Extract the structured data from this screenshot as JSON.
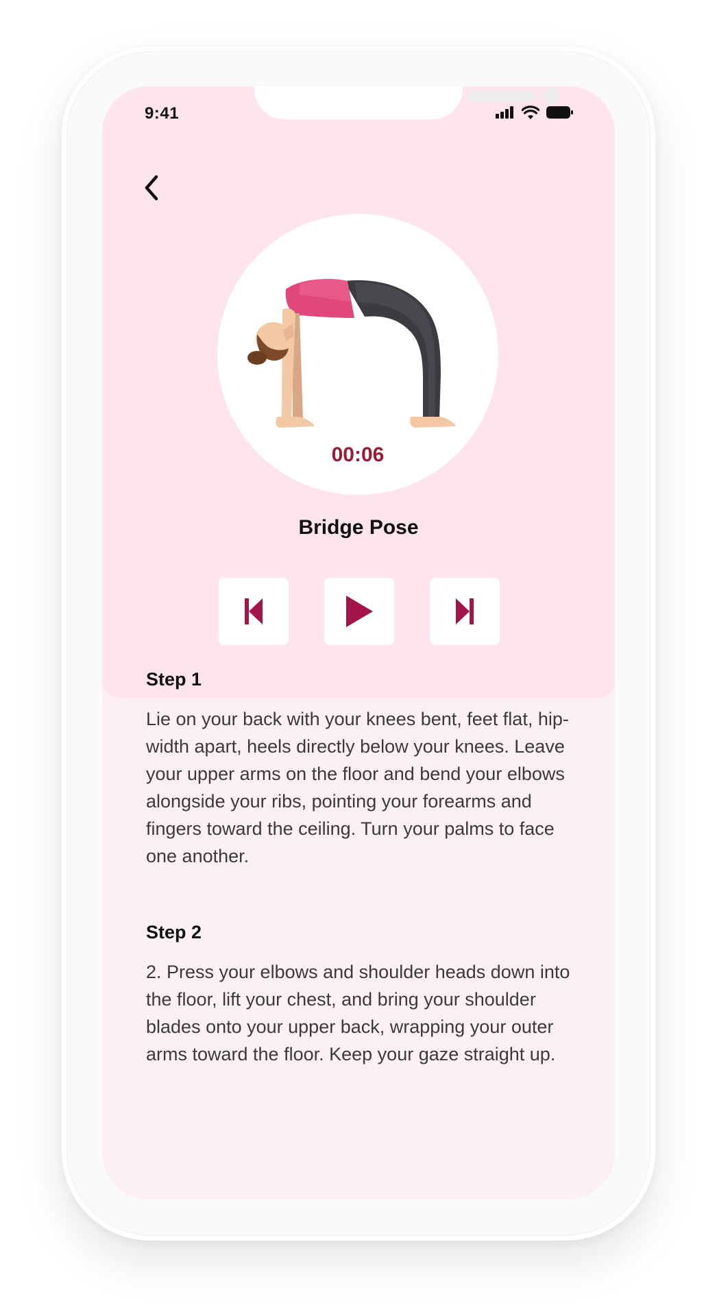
{
  "status_bar": {
    "time": "9:41",
    "icons": [
      "signal-icon",
      "wifi-icon",
      "battery-icon"
    ]
  },
  "nav": {
    "back_icon": "chevron-left-icon"
  },
  "exercise": {
    "timer": "00:06",
    "name": "Bridge Pose"
  },
  "controls": {
    "previous_icon": "skip-previous-icon",
    "play_icon": "play-icon",
    "next_icon": "skip-next-icon"
  },
  "steps": [
    {
      "title": "Step 1",
      "body": "Lie on your back with your knees bent, feet flat, hip-width apart, heels directly below your knees. Leave your upper arms on the floor and bend your elbows alongside your ribs, pointing your forearms and fingers toward the ceiling. Turn your palms to face one another."
    },
    {
      "title": "Step 2",
      "body": "2. Press your elbows and shoulder heads down into the floor, lift your chest, and bring your shoulder blades onto your upper back, wrapping your outer arms toward the floor. Keep your gaze straight up."
    }
  ],
  "colors": {
    "panel_pink": "#fde4ef",
    "screen_pink": "#fdf0f5",
    "accent": "#a3154a",
    "timer": "#9b1b36"
  }
}
